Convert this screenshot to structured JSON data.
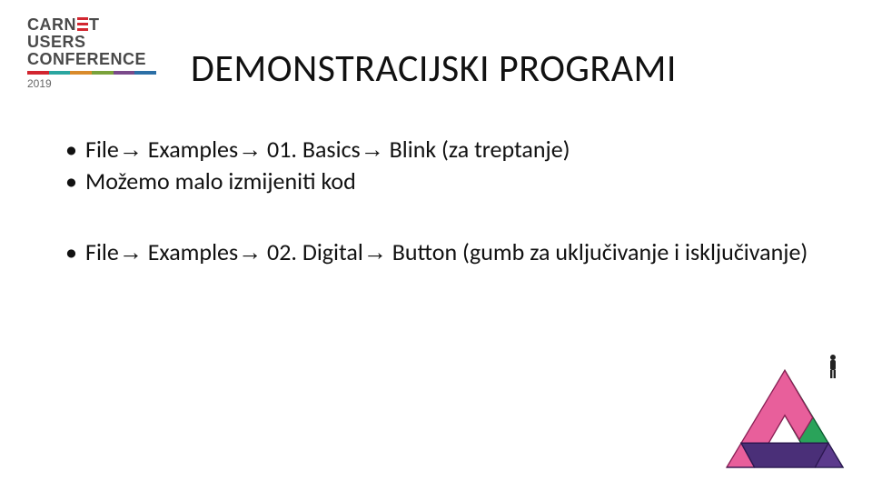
{
  "logo": {
    "line1_a": "CARN",
    "line1_b": "T",
    "line2": "USERS",
    "line3": "CONFERENCE",
    "year": "2019"
  },
  "title": "DEMONSTRACIJSKI PROGRAMI",
  "arrow": "→",
  "bullets": {
    "b1": {
      "p1": "File",
      "p2": " Examples",
      "p3": " 01. Basics",
      "p4": " Blink (za treptanje)"
    },
    "b2": "Možemo malo izmijeniti kod",
    "b3": {
      "p1": "File",
      "p2": " Examples",
      "p3": " 02. Digital",
      "p4": " Button  (gumb za uključivanje i isključivanje)"
    }
  }
}
